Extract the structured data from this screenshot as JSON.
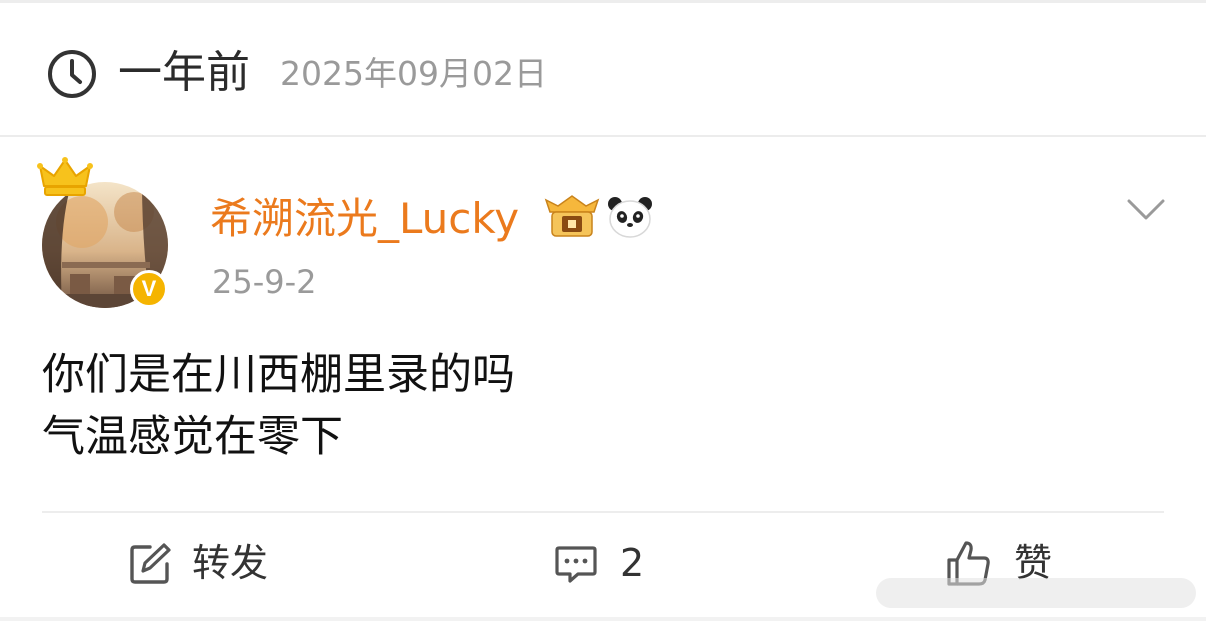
{
  "memory": {
    "title": "一年前",
    "date": "2025年09月02日",
    "icon": "clock-icon"
  },
  "post": {
    "username": "希溯流光_Lucky",
    "time": "25-9-2",
    "lines": [
      "你们是在川西棚里录的吗",
      "气温感觉在零下"
    ],
    "badges": [
      "crown-icon",
      "svip-icon",
      "panda-icon"
    ],
    "verified_mark": "V"
  },
  "actions": {
    "repost_label": "转发",
    "comment_count": "2",
    "like_label": "赞"
  },
  "colors": {
    "username": "#eb7a1d",
    "verified": "#f5b400",
    "muted": "#9a9a9a"
  }
}
